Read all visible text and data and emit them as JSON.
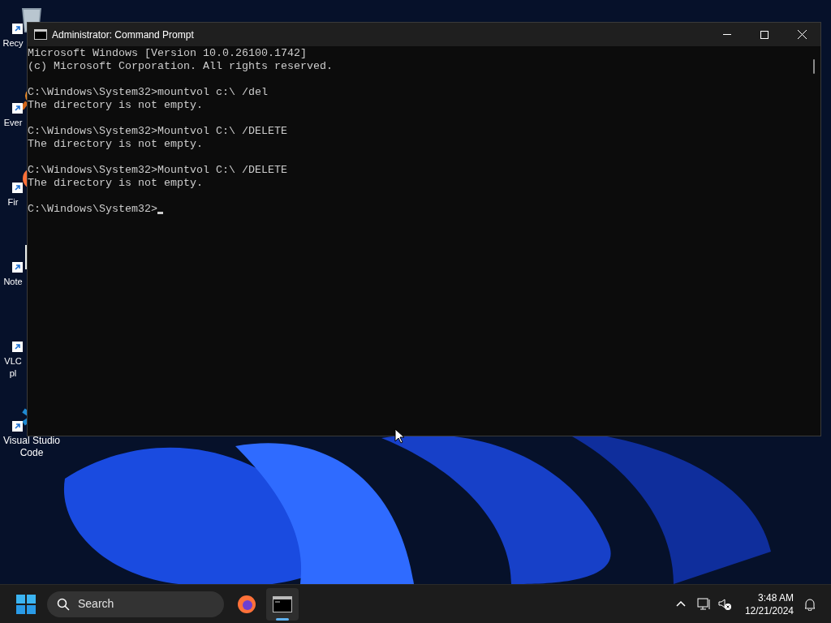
{
  "desktop_icons": [
    {
      "kind": "bin",
      "label": "Recy"
    },
    {
      "kind": "everything",
      "label": "Ever"
    },
    {
      "kind": "firefox",
      "label": "Fir"
    },
    {
      "kind": "notepad",
      "label": "Note"
    },
    {
      "kind": "vlc",
      "label": "VLC pl"
    },
    {
      "kind": "vscode",
      "label": "Visual Studio Code"
    }
  ],
  "window": {
    "title": "Administrator: Command Prompt"
  },
  "console": [
    {
      "kind": "line",
      "text": "Microsoft Windows [Version 10.0.26100.1742]"
    },
    {
      "kind": "line",
      "text": "(c) Microsoft Corporation. All rights reserved."
    },
    {
      "kind": "blank"
    },
    {
      "kind": "line",
      "text": "C:\\Windows\\System32>mountvol c:\\ /del"
    },
    {
      "kind": "line",
      "text": "The directory is not empty."
    },
    {
      "kind": "blank"
    },
    {
      "kind": "line",
      "text": "C:\\Windows\\System32>Mountvol C:\\ /DELETE"
    },
    {
      "kind": "line",
      "text": "The directory is not empty."
    },
    {
      "kind": "blank"
    },
    {
      "kind": "line",
      "text": "C:\\Windows\\System32>Mountvol C:\\ /DELETE"
    },
    {
      "kind": "line",
      "text": "The directory is not empty."
    },
    {
      "kind": "blank"
    },
    {
      "kind": "prompt",
      "text": "C:\\Windows\\System32>"
    }
  ],
  "taskbar": {
    "search": {
      "placeholder": "Search"
    },
    "apps": [
      {
        "kind": "firefox",
        "selected": false
      },
      {
        "kind": "terminal",
        "selected": true
      }
    ],
    "time": "3:48 AM",
    "date": "12/21/2024"
  }
}
